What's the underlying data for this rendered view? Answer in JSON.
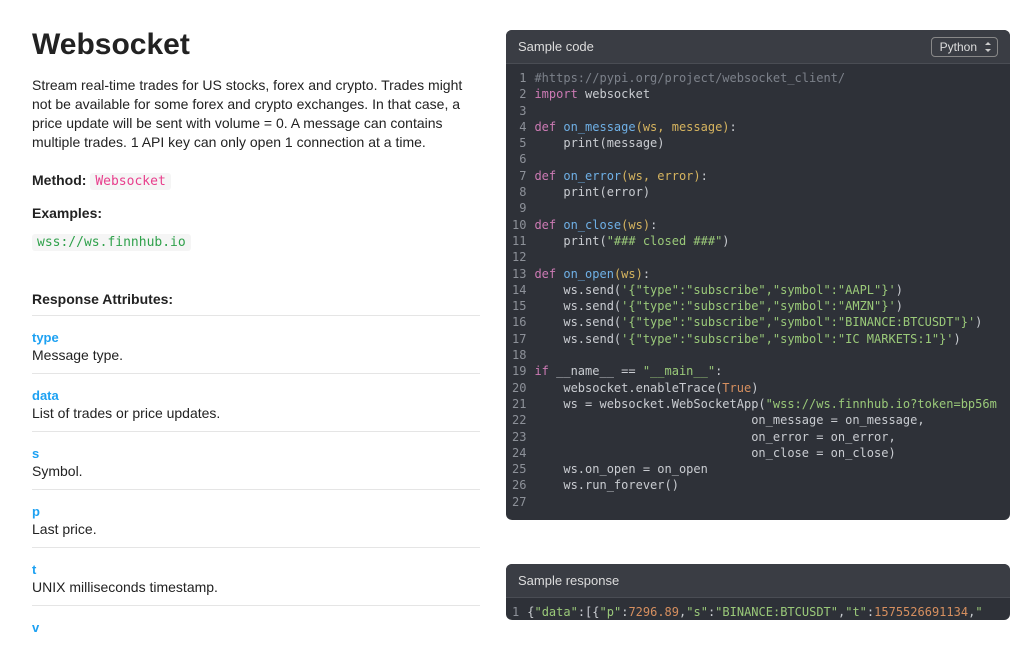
{
  "title": "Websocket",
  "description": "Stream real-time trades for US stocks, forex and crypto. Trades might not be available for some forex and crypto exchanges. In that case, a price update will be sent with volume = 0. A message can contains multiple trades. 1 API key can only open 1 connection at a time.",
  "method_label": "Method:",
  "method_value": "Websocket",
  "examples_label": "Examples:",
  "example_url": "wss://ws.finnhub.io",
  "response_attributes_label": "Response Attributes:",
  "attributes": [
    {
      "name": "type",
      "desc": "Message type."
    },
    {
      "name": "data",
      "desc": "List of trades or price updates."
    },
    {
      "name": "s",
      "desc": "Symbol."
    },
    {
      "name": "p",
      "desc": "Last price."
    },
    {
      "name": "t",
      "desc": "UNIX milliseconds timestamp."
    },
    {
      "name": "v",
      "desc": ""
    }
  ],
  "sample_code_title": "Sample code",
  "language_selected": "Python",
  "code": {
    "lines": 27,
    "l1": "#https://pypi.org/project/websocket_client/",
    "l2a": "import",
    "l2b": " websocket",
    "l4a": "def ",
    "l4b": "on_message",
    "l4c": "(ws, message)",
    "l4d": ":",
    "l5": "    print(message)",
    "l7a": "def ",
    "l7b": "on_error",
    "l7c": "(ws, error)",
    "l7d": ":",
    "l8": "    print(error)",
    "l10a": "def ",
    "l10b": "on_close",
    "l10c": "(ws)",
    "l10d": ":",
    "l11a": "    print(",
    "l11b": "\"### closed ###\"",
    "l11c": ")",
    "l13a": "def ",
    "l13b": "on_open",
    "l13c": "(ws)",
    "l13d": ":",
    "l14a": "    ws.send(",
    "l14b": "'{\"type\":\"subscribe\",\"symbol\":\"AAPL\"}'",
    "l14c": ")",
    "l15a": "    ws.send(",
    "l15b": "'{\"type\":\"subscribe\",\"symbol\":\"AMZN\"}'",
    "l15c": ")",
    "l16a": "    ws.send(",
    "l16b": "'{\"type\":\"subscribe\",\"symbol\":\"BINANCE:BTCUSDT\"}'",
    "l16c": ")",
    "l17a": "    ws.send(",
    "l17b": "'{\"type\":\"subscribe\",\"symbol\":\"IC MARKETS:1\"}'",
    "l17c": ")",
    "l19a": "if",
    "l19b": " __name__ == ",
    "l19c": "\"__main__\"",
    "l19d": ":",
    "l20a": "    websocket.enableTrace(",
    "l20b": "True",
    "l20c": ")",
    "l21a": "    ws = websocket.WebSocketApp(",
    "l21b": "\"wss://ws.finnhub.io?token=bp56m",
    "l21c": "",
    "l22": "                              on_message = on_message,",
    "l23": "                              on_error = on_error,",
    "l24": "                              on_close = on_close)",
    "l25": "    ws.on_open = on_open",
    "l26": "    ws.run_forever()"
  },
  "sample_response_title": "Sample response",
  "response": {
    "l1a": "{",
    "l1b": "\"data\"",
    "l1c": ":[{",
    "l1d": "\"p\"",
    "l1e": ":",
    "l1f": "7296.89",
    "l1g": ",",
    "l1h": "\"s\"",
    "l1i": ":",
    "l1j": "\"BINANCE:BTCUSDT\"",
    "l1k": ",",
    "l1l": "\"t\"",
    "l1m": ":",
    "l1n": "1575526691134",
    "l1o": ",",
    "l1p": "\""
  }
}
